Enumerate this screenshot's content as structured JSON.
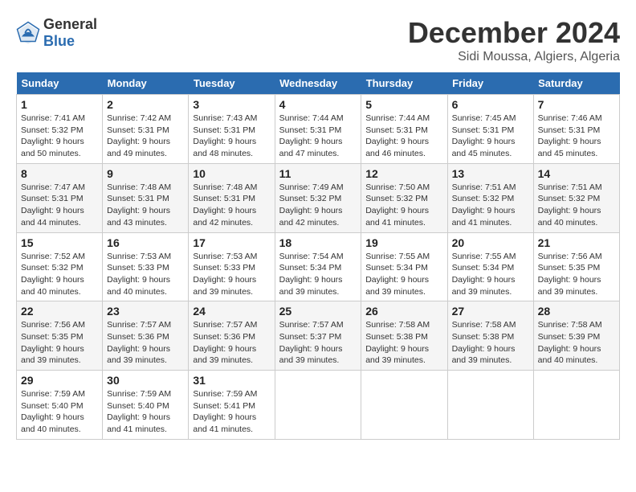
{
  "header": {
    "logo_general": "General",
    "logo_blue": "Blue",
    "month_title": "December 2024",
    "location": "Sidi Moussa, Algiers, Algeria"
  },
  "days_of_week": [
    "Sunday",
    "Monday",
    "Tuesday",
    "Wednesday",
    "Thursday",
    "Friday",
    "Saturday"
  ],
  "weeks": [
    [
      {
        "day": "1",
        "sunrise": "7:41 AM",
        "sunset": "5:32 PM",
        "daylight": "9 hours and 50 minutes."
      },
      {
        "day": "2",
        "sunrise": "7:42 AM",
        "sunset": "5:31 PM",
        "daylight": "9 hours and 49 minutes."
      },
      {
        "day": "3",
        "sunrise": "7:43 AM",
        "sunset": "5:31 PM",
        "daylight": "9 hours and 48 minutes."
      },
      {
        "day": "4",
        "sunrise": "7:44 AM",
        "sunset": "5:31 PM",
        "daylight": "9 hours and 47 minutes."
      },
      {
        "day": "5",
        "sunrise": "7:44 AM",
        "sunset": "5:31 PM",
        "daylight": "9 hours and 46 minutes."
      },
      {
        "day": "6",
        "sunrise": "7:45 AM",
        "sunset": "5:31 PM",
        "daylight": "9 hours and 45 minutes."
      },
      {
        "day": "7",
        "sunrise": "7:46 AM",
        "sunset": "5:31 PM",
        "daylight": "9 hours and 45 minutes."
      }
    ],
    [
      {
        "day": "8",
        "sunrise": "7:47 AM",
        "sunset": "5:31 PM",
        "daylight": "9 hours and 44 minutes."
      },
      {
        "day": "9",
        "sunrise": "7:48 AM",
        "sunset": "5:31 PM",
        "daylight": "9 hours and 43 minutes."
      },
      {
        "day": "10",
        "sunrise": "7:48 AM",
        "sunset": "5:31 PM",
        "daylight": "9 hours and 42 minutes."
      },
      {
        "day": "11",
        "sunrise": "7:49 AM",
        "sunset": "5:32 PM",
        "daylight": "9 hours and 42 minutes."
      },
      {
        "day": "12",
        "sunrise": "7:50 AM",
        "sunset": "5:32 PM",
        "daylight": "9 hours and 41 minutes."
      },
      {
        "day": "13",
        "sunrise": "7:51 AM",
        "sunset": "5:32 PM",
        "daylight": "9 hours and 41 minutes."
      },
      {
        "day": "14",
        "sunrise": "7:51 AM",
        "sunset": "5:32 PM",
        "daylight": "9 hours and 40 minutes."
      }
    ],
    [
      {
        "day": "15",
        "sunrise": "7:52 AM",
        "sunset": "5:32 PM",
        "daylight": "9 hours and 40 minutes."
      },
      {
        "day": "16",
        "sunrise": "7:53 AM",
        "sunset": "5:33 PM",
        "daylight": "9 hours and 40 minutes."
      },
      {
        "day": "17",
        "sunrise": "7:53 AM",
        "sunset": "5:33 PM",
        "daylight": "9 hours and 39 minutes."
      },
      {
        "day": "18",
        "sunrise": "7:54 AM",
        "sunset": "5:34 PM",
        "daylight": "9 hours and 39 minutes."
      },
      {
        "day": "19",
        "sunrise": "7:55 AM",
        "sunset": "5:34 PM",
        "daylight": "9 hours and 39 minutes."
      },
      {
        "day": "20",
        "sunrise": "7:55 AM",
        "sunset": "5:34 PM",
        "daylight": "9 hours and 39 minutes."
      },
      {
        "day": "21",
        "sunrise": "7:56 AM",
        "sunset": "5:35 PM",
        "daylight": "9 hours and 39 minutes."
      }
    ],
    [
      {
        "day": "22",
        "sunrise": "7:56 AM",
        "sunset": "5:35 PM",
        "daylight": "9 hours and 39 minutes."
      },
      {
        "day": "23",
        "sunrise": "7:57 AM",
        "sunset": "5:36 PM",
        "daylight": "9 hours and 39 minutes."
      },
      {
        "day": "24",
        "sunrise": "7:57 AM",
        "sunset": "5:36 PM",
        "daylight": "9 hours and 39 minutes."
      },
      {
        "day": "25",
        "sunrise": "7:57 AM",
        "sunset": "5:37 PM",
        "daylight": "9 hours and 39 minutes."
      },
      {
        "day": "26",
        "sunrise": "7:58 AM",
        "sunset": "5:38 PM",
        "daylight": "9 hours and 39 minutes."
      },
      {
        "day": "27",
        "sunrise": "7:58 AM",
        "sunset": "5:38 PM",
        "daylight": "9 hours and 39 minutes."
      },
      {
        "day": "28",
        "sunrise": "7:58 AM",
        "sunset": "5:39 PM",
        "daylight": "9 hours and 40 minutes."
      }
    ],
    [
      {
        "day": "29",
        "sunrise": "7:59 AM",
        "sunset": "5:40 PM",
        "daylight": "9 hours and 40 minutes."
      },
      {
        "day": "30",
        "sunrise": "7:59 AM",
        "sunset": "5:40 PM",
        "daylight": "9 hours and 41 minutes."
      },
      {
        "day": "31",
        "sunrise": "7:59 AM",
        "sunset": "5:41 PM",
        "daylight": "9 hours and 41 minutes."
      },
      null,
      null,
      null,
      null
    ]
  ]
}
